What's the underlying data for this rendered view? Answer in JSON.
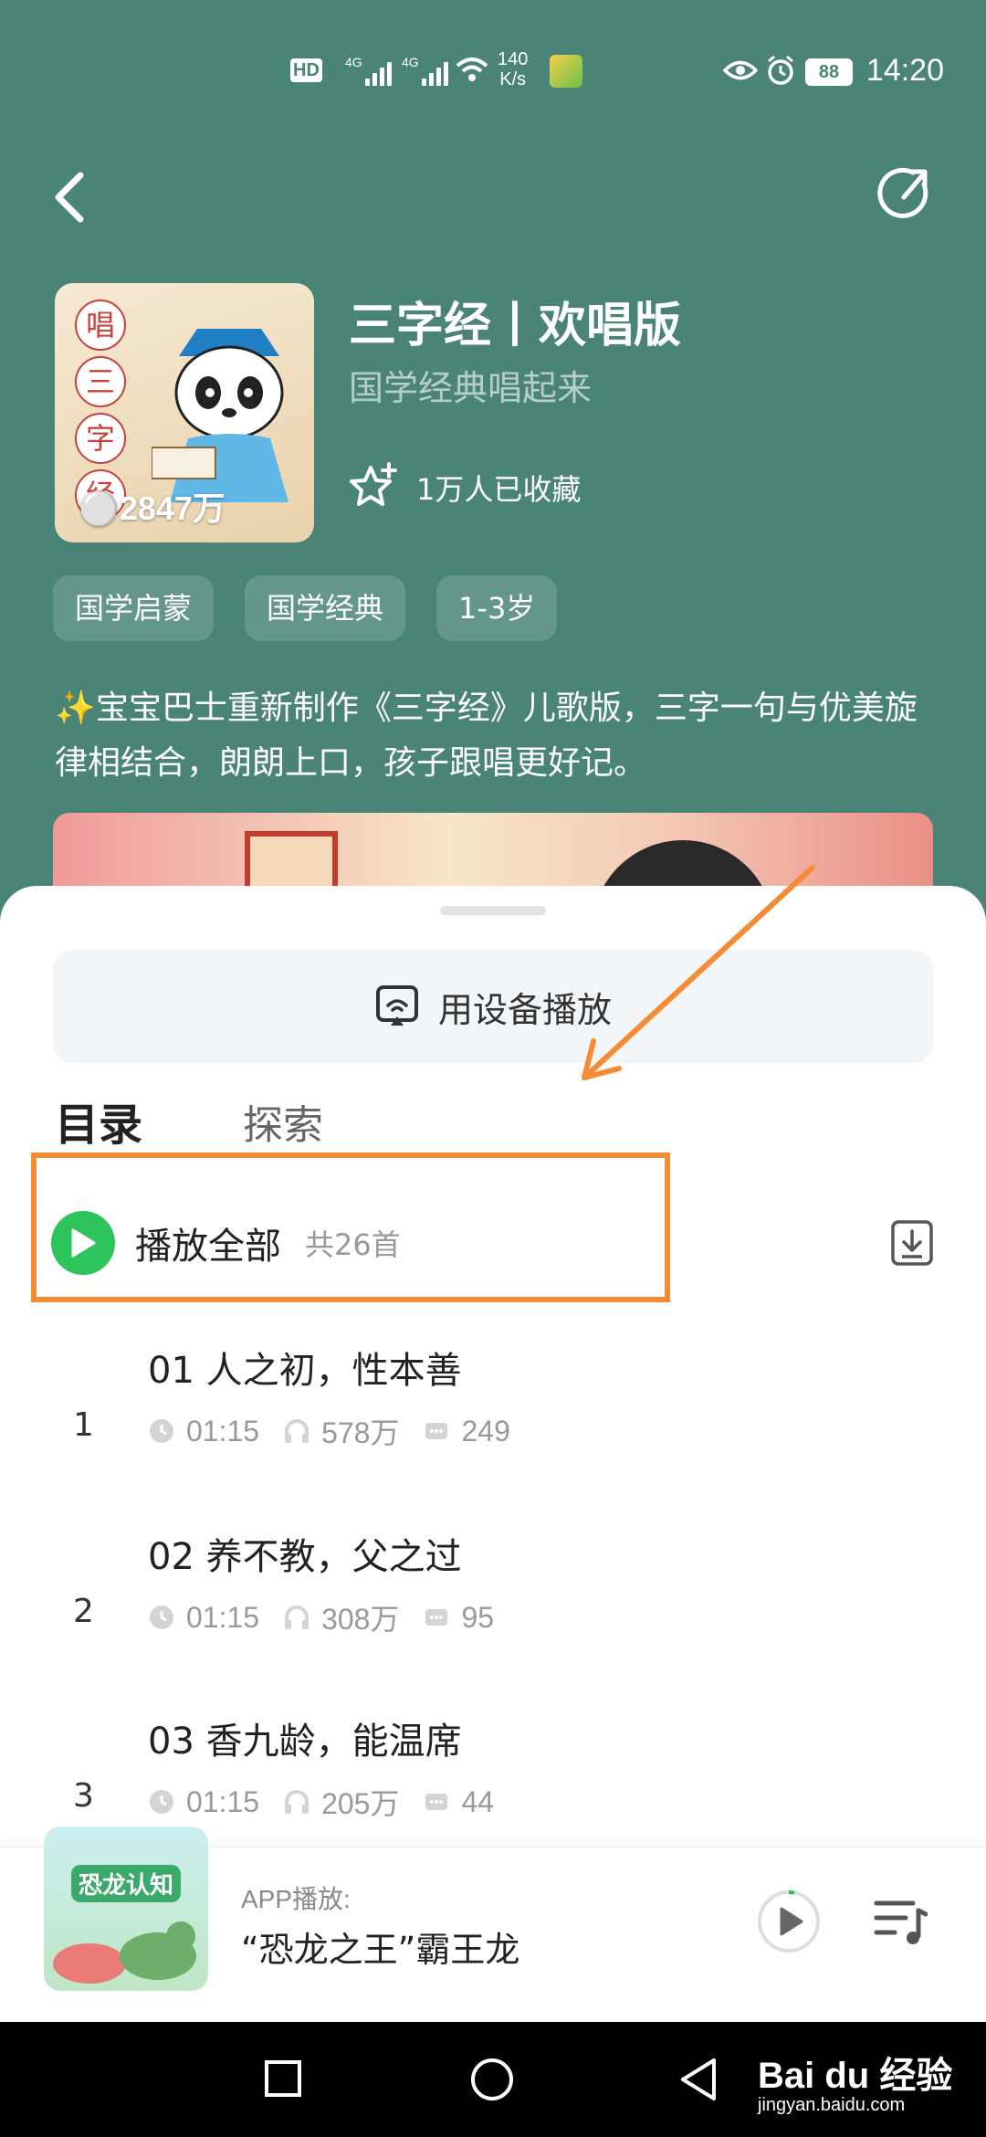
{
  "status_bar": {
    "time": "14:20",
    "hd_label": "HD",
    "net1": "4G",
    "net2": "4G",
    "speed_value": "140",
    "speed_unit": "K/s",
    "battery": "88"
  },
  "album": {
    "title": "三字经丨欢唱版",
    "subtitle": "国学经典唱起来",
    "play_count": "2847万",
    "cover_text": [
      "唱",
      "三",
      "字",
      "经"
    ],
    "favorites": "1万人已收藏",
    "tags": [
      "国学启蒙",
      "国学经典",
      "1-3岁"
    ],
    "description": "✨宝宝巴士重新制作《三字经》儿歌版，三字一句与优美旋律相结合，朗朗上口，孩子跟唱更好记。"
  },
  "sheet": {
    "device_button": "用设备播放",
    "tabs": [
      "目录",
      "探索"
    ],
    "play_all_label": "播放全部",
    "play_all_count": "共26首"
  },
  "tracks": [
    {
      "index": "1",
      "name": "01 人之初，性本善",
      "duration": "01:15",
      "plays": "578万",
      "comments": "249"
    },
    {
      "index": "2",
      "name": "02 养不教，父之过",
      "duration": "01:15",
      "plays": "308万",
      "comments": "95"
    },
    {
      "index": "3",
      "name": "03 香九龄，能温席",
      "duration": "01:15",
      "plays": "205万",
      "comments": "44"
    }
  ],
  "mini_player": {
    "source_label": "APP播放:",
    "title": "“恐龙之王”霸王龙",
    "cover_logo": "恐龙认知"
  },
  "watermark": {
    "brand": "Bai du 经验",
    "url": "jingyan.baidu.com"
  },
  "colors": {
    "header_bg": "#4a8477",
    "accent_green": "#2ec45c",
    "highlight_orange": "#f58b35"
  }
}
